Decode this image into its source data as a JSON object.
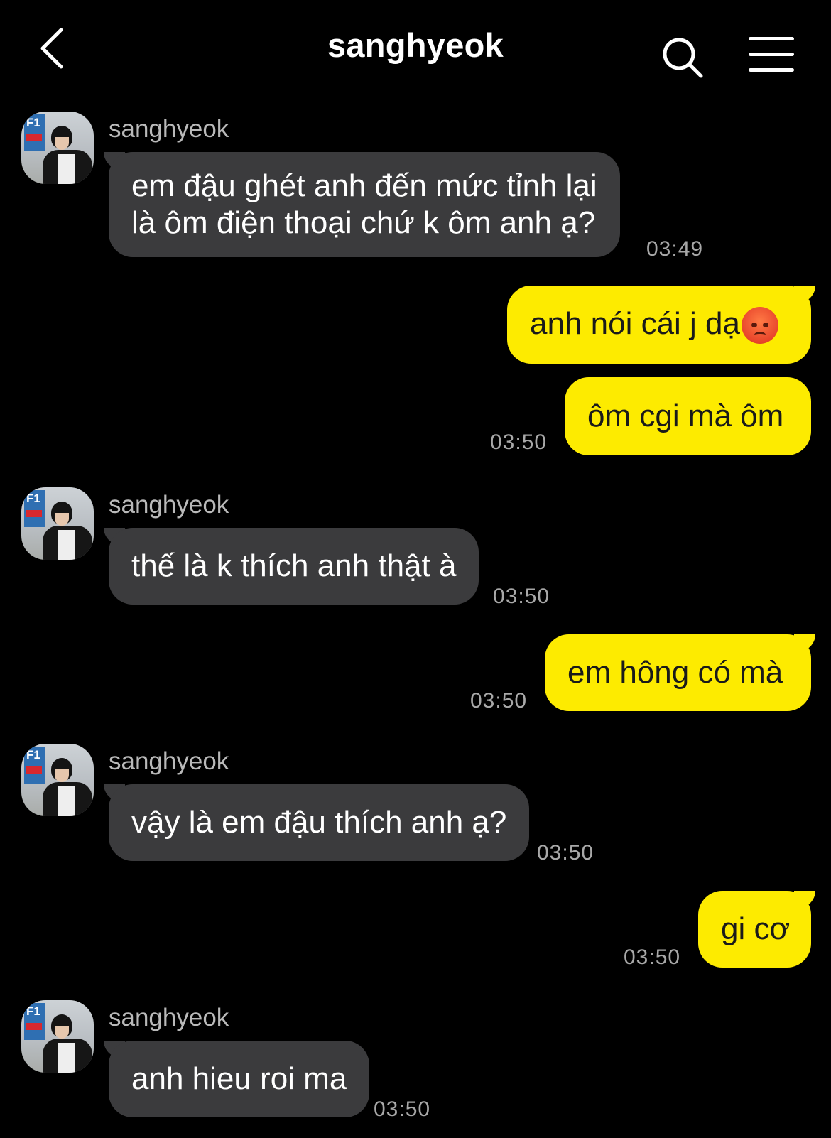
{
  "header": {
    "title": "sanghyeok"
  },
  "messages": [
    {
      "side": "in",
      "sender": "sanghyeok",
      "lines": [
        "em đậu ghét anh đến mức tỉnh lại",
        "là ôm điện thoại chứ k ôm anh ạ?"
      ],
      "time": "03:49"
    },
    {
      "side": "out",
      "text": "anh nói cái j dạ",
      "emoji": "angry-face-emoji"
    },
    {
      "side": "out",
      "text": "ôm cgi mà ôm",
      "time": "03:50"
    },
    {
      "side": "in",
      "sender": "sanghyeok",
      "text": "thế là k thích anh thật à",
      "time": "03:50"
    },
    {
      "side": "out",
      "text": "em hông có mà",
      "time": "03:50"
    },
    {
      "side": "in",
      "sender": "sanghyeok",
      "text": "vậy là em đậu thích anh ạ?",
      "time": "03:50"
    },
    {
      "side": "out",
      "text": "gi cơ",
      "time": "03:50"
    },
    {
      "side": "in",
      "sender": "sanghyeok",
      "text": "anh hieu roi ma",
      "time": "03:50"
    }
  ],
  "colors": {
    "background": "#000000",
    "incoming_bubble": "#3b3b3d",
    "outgoing_bubble": "#fdeb00",
    "timestamp": "#a8a8a8"
  },
  "icons": {
    "back": "chevron-left-icon",
    "search": "search-icon",
    "menu": "hamburger-menu-icon"
  }
}
